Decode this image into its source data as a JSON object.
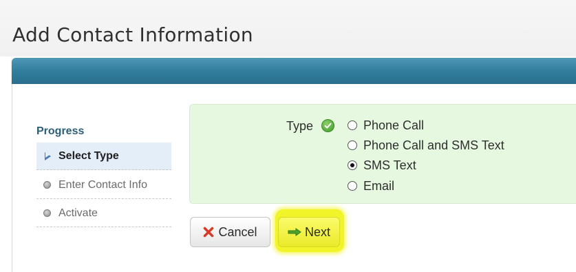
{
  "page": {
    "title": "Add Contact Information"
  },
  "progress": {
    "heading": "Progress",
    "steps": [
      {
        "label": "Select Type",
        "state": "active",
        "icon": "triangle-right-icon"
      },
      {
        "label": "Enter Contact Info",
        "state": "pending",
        "icon": "dot-icon"
      },
      {
        "label": "Activate",
        "state": "pending",
        "icon": "dot-icon"
      }
    ]
  },
  "type_selector": {
    "label": "Type",
    "status_icon": "check-circle-icon",
    "options": [
      {
        "label": "Phone Call",
        "selected": false
      },
      {
        "label": "Phone Call and SMS Text",
        "selected": false
      },
      {
        "label": "SMS Text",
        "selected": true
      },
      {
        "label": "Email",
        "selected": false
      }
    ]
  },
  "buttons": {
    "cancel_label": "Cancel",
    "cancel_icon": "x-icon",
    "next_label": "Next",
    "next_icon": "arrow-right-icon",
    "highlight_color": "#f2f42a"
  },
  "colors": {
    "header_blue": "#2f7c9c",
    "type_panel_green": "#e6f9e0",
    "progress_heading": "#2d5e78",
    "cancel_x_red": "#d83a2a",
    "check_green": "#3e9a2a"
  }
}
